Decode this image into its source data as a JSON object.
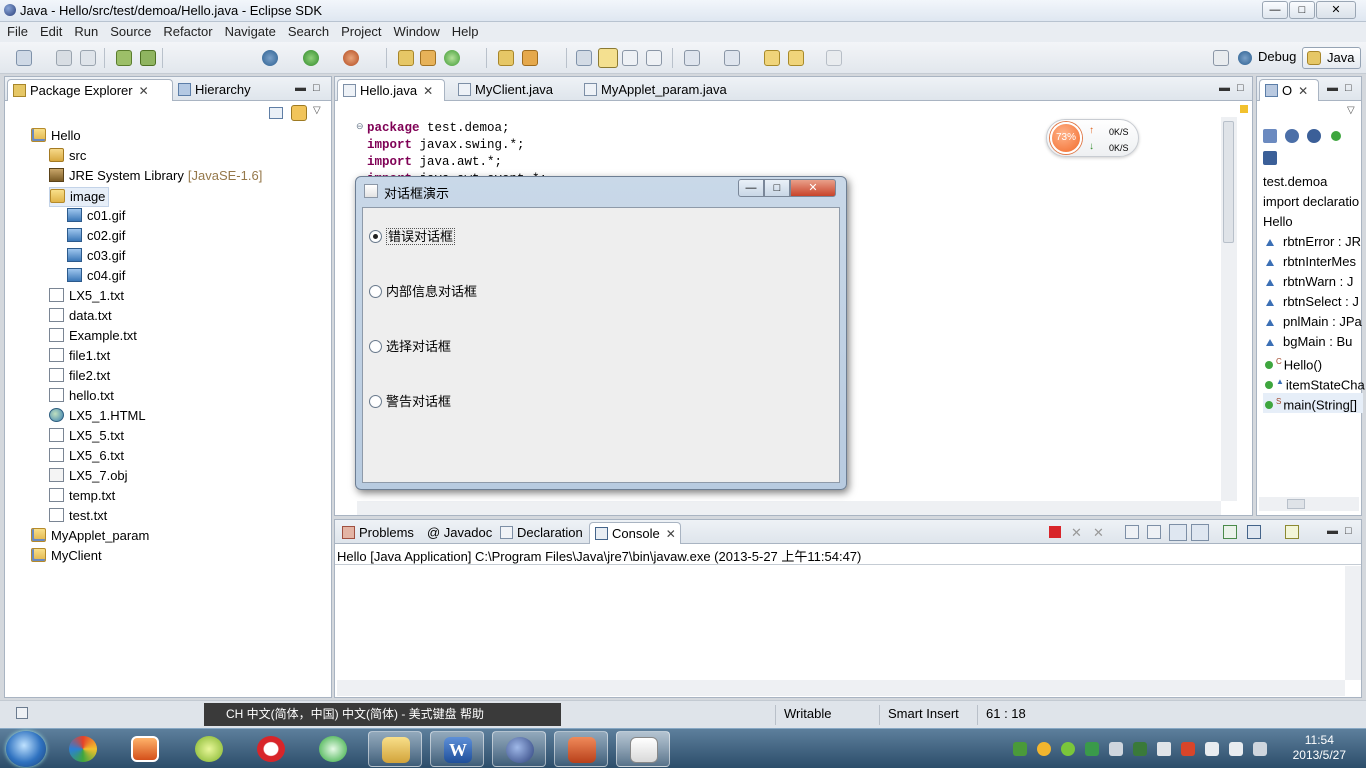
{
  "window": {
    "title": "Java - Hello/src/test/demoa/Hello.java - Eclipse SDK"
  },
  "menu": [
    "File",
    "Edit",
    "Run",
    "Source",
    "Refactor",
    "Navigate",
    "Search",
    "Project",
    "Window",
    "Help"
  ],
  "perspectives": {
    "debug": "Debug",
    "java": "Java"
  },
  "explorer": {
    "tabs": [
      "Package Explorer",
      "Hierarchy"
    ],
    "tree": [
      {
        "label": "Hello",
        "icon": "project-icon",
        "level": 0
      },
      {
        "label": "src",
        "icon": "source-folder-icon",
        "level": 1
      },
      {
        "label": "JRE System Library",
        "suffix": "[JavaSE-1.6]",
        "icon": "library-icon",
        "level": 1
      },
      {
        "label": "image",
        "icon": "folder-icon",
        "level": 1
      },
      {
        "label": "c01.gif",
        "icon": "image-file-icon",
        "level": 2
      },
      {
        "label": "c02.gif",
        "icon": "image-file-icon",
        "level": 2
      },
      {
        "label": "c03.gif",
        "icon": "image-file-icon",
        "level": 2
      },
      {
        "label": "c04.gif",
        "icon": "image-file-icon",
        "level": 2
      },
      {
        "label": "LX5_1.txt",
        "icon": "text-file-icon",
        "level": 1
      },
      {
        "label": "data.txt",
        "icon": "text-file-icon",
        "level": 1
      },
      {
        "label": "Example.txt",
        "icon": "text-file-icon",
        "level": 1
      },
      {
        "label": "file1.txt",
        "icon": "text-file-icon",
        "level": 1
      },
      {
        "label": "file2.txt",
        "icon": "text-file-icon",
        "level": 1
      },
      {
        "label": "hello.txt",
        "icon": "text-file-icon",
        "level": 1
      },
      {
        "label": "LX5_1.HTML",
        "icon": "html-file-icon",
        "level": 1
      },
      {
        "label": "LX5_5.txt",
        "icon": "text-file-icon",
        "level": 1
      },
      {
        "label": "LX5_6.txt",
        "icon": "text-file-icon",
        "level": 1
      },
      {
        "label": "LX5_7.obj",
        "icon": "object-file-icon",
        "level": 1
      },
      {
        "label": "temp.txt",
        "icon": "text-file-icon",
        "level": 1
      },
      {
        "label": "test.txt",
        "icon": "text-file-icon",
        "level": 1
      },
      {
        "label": "MyApplet_param",
        "icon": "project-icon",
        "level": 0
      },
      {
        "label": "MyClient",
        "icon": "project-icon",
        "level": 0
      }
    ]
  },
  "editor": {
    "tabs": [
      "Hello.java",
      "MyClient.java",
      "MyApplet_param.java"
    ],
    "lines": [
      {
        "kw": "package",
        "rest": " test.demoa;"
      },
      {
        "kw": "import",
        "rest": " javax.swing.*;"
      },
      {
        "kw": "import",
        "rest": " java.awt.*;"
      },
      {
        "kw": "import",
        "rest": " java.awt.event.*;"
      }
    ]
  },
  "network": {
    "percent": "73%",
    "up": "0K/S",
    "down": "0K/S"
  },
  "dialog": {
    "title": "对话框演示",
    "options": [
      "错误对话框",
      "内部信息对话框",
      "选择对话框",
      "警告对话框"
    ],
    "selected": 0
  },
  "outline": {
    "title": "O",
    "items": [
      {
        "label": "test.demoa",
        "kind": "package"
      },
      {
        "label": "import declaratio",
        "kind": "imports"
      },
      {
        "label": "Hello",
        "kind": "class"
      },
      {
        "label": "rbtnError : JR",
        "kind": "field"
      },
      {
        "label": "rbtnInterMes",
        "kind": "field"
      },
      {
        "label": "rbtnWarn : J",
        "kind": "field"
      },
      {
        "label": "rbtnSelect : J",
        "kind": "field"
      },
      {
        "label": "pnlMain : JPa",
        "kind": "field"
      },
      {
        "label": "bgMain : Bu",
        "kind": "field"
      },
      {
        "label": "Hello()",
        "kind": "constructor",
        "mark": "C"
      },
      {
        "label": "itemStateCha",
        "kind": "method"
      },
      {
        "label": "main(String[]",
        "kind": "method",
        "mark": "S"
      }
    ]
  },
  "bottom": {
    "tabs": [
      "Problems",
      "@ Javadoc",
      "Declaration",
      "Console"
    ],
    "console_header": "Hello [Java Application] C:\\Program Files\\Java\\jre7\\bin\\javaw.exe (2013-5-27 上午11:54:47)"
  },
  "ime": {
    "text": "CH 中文(简体，中国)   中文(简体) - 美式键盘  帮助"
  },
  "status": {
    "writable": "Writable",
    "insert": "Smart Insert",
    "position": "61 : 18"
  },
  "clock": {
    "time": "11:54",
    "date": "2013/5/27"
  },
  "colors": {
    "keyword": "#7f0055",
    "accent": "#f26b2b"
  }
}
